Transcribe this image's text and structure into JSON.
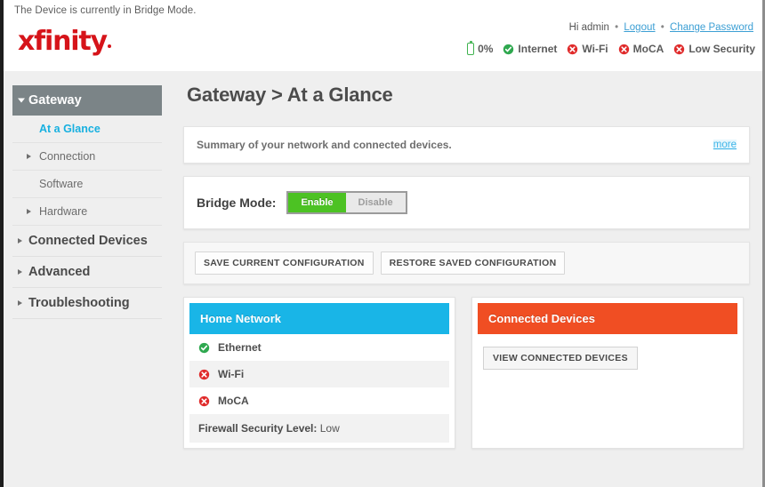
{
  "notice": "The Device is currently in Bridge Mode.",
  "brand": {
    "logo_text": "xfinity",
    "logo_color": "#d6141a"
  },
  "account": {
    "greeting": "Hi admin",
    "logout_label": "Logout",
    "change_password_label": "Change Password",
    "separator": "•"
  },
  "status_bar": {
    "items": [
      {
        "icon": "battery-icon",
        "label": "0%",
        "color": "#3fb34f"
      },
      {
        "icon": "check-circle-icon",
        "label": "Internet",
        "color": "#2fa84f"
      },
      {
        "icon": "x-circle-icon",
        "label": "Wi-Fi",
        "color": "#e02b2b"
      },
      {
        "icon": "x-circle-icon",
        "label": "MoCA",
        "color": "#e02b2b"
      },
      {
        "icon": "x-circle-icon",
        "label": "Low Security",
        "color": "#e02b2b"
      }
    ]
  },
  "sidebar": {
    "items": [
      {
        "label": "Gateway",
        "level": "top",
        "active": true,
        "caret": "chevron-down-icon"
      },
      {
        "label": "At a Glance",
        "level": "sub",
        "current": true,
        "caret": "none"
      },
      {
        "label": "Connection",
        "level": "sub",
        "caret": "chevron-right-icon"
      },
      {
        "label": "Software",
        "level": "sub",
        "caret": "none"
      },
      {
        "label": "Hardware",
        "level": "sub",
        "caret": "chevron-right-icon"
      },
      {
        "label": "Connected Devices",
        "level": "top",
        "caret": "chevron-right-icon"
      },
      {
        "label": "Advanced",
        "level": "top",
        "caret": "chevron-right-icon"
      },
      {
        "label": "Troubleshooting",
        "level": "top",
        "caret": "chevron-right-icon"
      }
    ]
  },
  "main": {
    "page_title": "Gateway > At a Glance",
    "summary": {
      "text": "Summary of your network and connected devices.",
      "more_label": "more"
    },
    "bridge_mode": {
      "label": "Bridge Mode:",
      "enable_label": "Enable",
      "disable_label": "Disable",
      "selected": "Enable",
      "enable_color": "#4cc223"
    },
    "config_buttons": {
      "save_label": "SAVE CURRENT CONFIGURATION",
      "restore_label": "RESTORE SAVED CONFIGURATION"
    },
    "home_network": {
      "title": "Home Network",
      "header_color": "#19b5e7",
      "rows": [
        {
          "icon": "check-circle-icon",
          "label": "Ethernet",
          "status": "ok"
        },
        {
          "icon": "x-circle-icon",
          "label": "Wi-Fi",
          "status": "error"
        },
        {
          "icon": "x-circle-icon",
          "label": "MoCA",
          "status": "error"
        }
      ],
      "firewall_label": "Firewall Security Level:",
      "firewall_value": "Low"
    },
    "connected_devices": {
      "title": "Connected Devices",
      "header_color": "#f04e23",
      "view_button_label": "VIEW CONNECTED DEVICES"
    }
  }
}
